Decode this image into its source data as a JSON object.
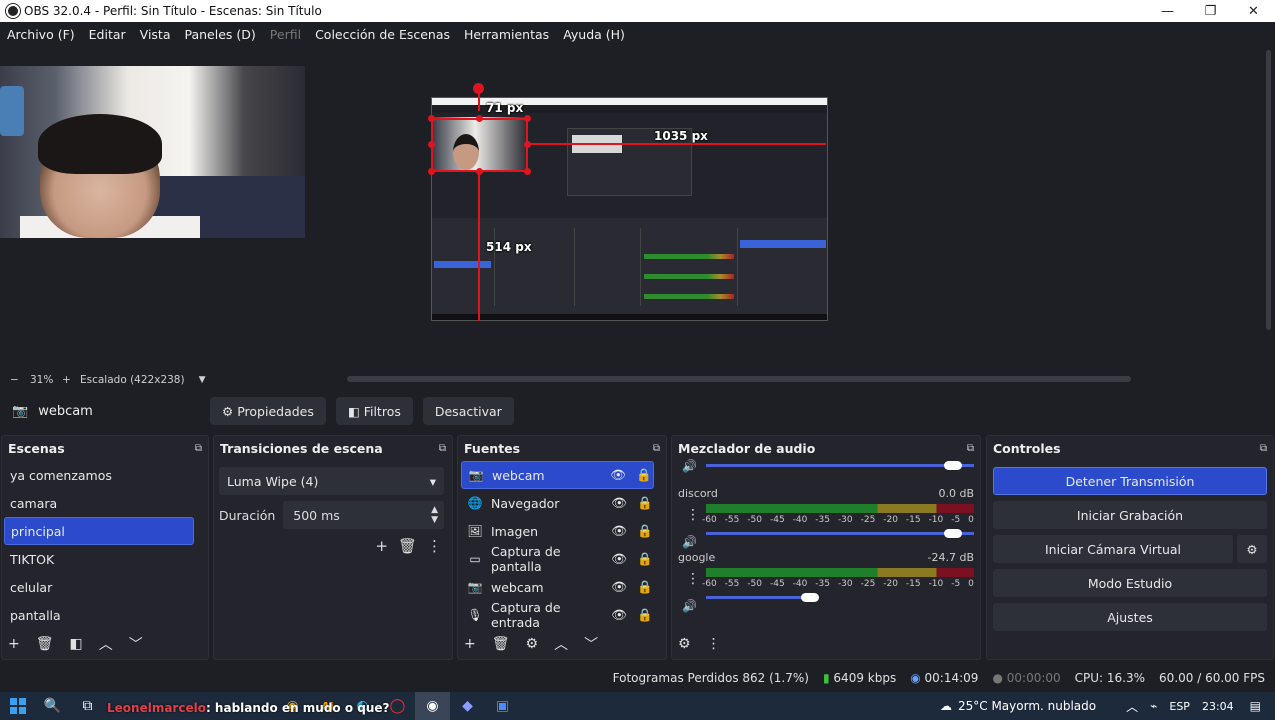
{
  "window": {
    "title": "OBS 32.0.4 - Perfil: Sin Título - Escenas: Sin Título",
    "controls": [
      "—",
      "❐",
      "✕"
    ]
  },
  "menu": [
    {
      "label": "Archivo (F)",
      "disabled": false
    },
    {
      "label": "Editar",
      "disabled": false
    },
    {
      "label": "Vista",
      "disabled": false
    },
    {
      "label": "Paneles (D)",
      "disabled": false
    },
    {
      "label": "Perfil",
      "disabled": true
    },
    {
      "label": "Colección de Escenas",
      "disabled": false
    },
    {
      "label": "Herramientas",
      "disabled": false
    },
    {
      "label": "Ayuda (H)",
      "disabled": false
    }
  ],
  "preview": {
    "labels": {
      "top": "71 px",
      "right": "1035 px",
      "left": "514 px"
    },
    "zoom": {
      "minus": "−",
      "percent": "31%",
      "plus": "+",
      "scaled": "Escalado (422x238)",
      "caret": "▼"
    }
  },
  "selected_source": {
    "name": "webcam",
    "properties": "Propiedades",
    "filters": "Filtros",
    "deactivate": "Desactivar"
  },
  "scenes": {
    "title": "Escenas",
    "items": [
      "ya comenzamos",
      "camara",
      "principal",
      "TIKTOK",
      "celular",
      "pantalla"
    ],
    "active_index": 2
  },
  "transitions": {
    "title": "Transiciones de escena",
    "selected": "Luma Wipe (4)",
    "duration_label": "Duración",
    "duration_value": "500 ms"
  },
  "sources": {
    "title": "Fuentes",
    "items": [
      {
        "label": "webcam",
        "icon": "camera-icon",
        "glyph": "📷",
        "active": true
      },
      {
        "label": "Navegador",
        "icon": "globe-icon",
        "glyph": "🌐",
        "active": false
      },
      {
        "label": "Imagen",
        "icon": "image-icon",
        "glyph": "🖼",
        "active": false
      },
      {
        "label": "Captura de pantalla",
        "icon": "monitor-icon",
        "glyph": "▭",
        "active": false
      },
      {
        "label": "webcam",
        "icon": "camera-icon",
        "glyph": "📷",
        "active": false
      },
      {
        "label": "Captura de entrada",
        "icon": "microphone-icon",
        "glyph": "🎙",
        "active": false
      }
    ]
  },
  "mixer": {
    "title": "Mezclador de audio",
    "ticks": [
      "-60",
      "-55",
      "-50",
      "-45",
      "-40",
      "-35",
      "-30",
      "-25",
      "-20",
      "-15",
      "-10",
      "-5",
      "0"
    ],
    "channels": [
      {
        "name": "discord",
        "level": "0.0 dB",
        "volume": 1.0
      },
      {
        "name": "google",
        "level": "-24.7 dB",
        "volume": 0.4
      }
    ],
    "top_volume": 1.0
  },
  "controls": {
    "title": "Controles",
    "stop_stream": "Detener Transmisión",
    "start_recording": "Iniciar Grabación",
    "virtual_cam": "Iniciar Cámara Virtual",
    "studio_mode": "Modo Estudio",
    "settings": "Ajustes"
  },
  "status": {
    "dropped": "Fotogramas Perdidos 862 (1.7%)",
    "bitrate": "6409 kbps",
    "stream_time": "00:14:09",
    "rec_time": "00:00:00",
    "cpu": "CPU: 16.3%",
    "fps": "60.00 / 60.00 FPS"
  },
  "taskbar": {
    "overlay_user": "Leonelmarcelo",
    "overlay_text": ": hablando en mudo o que?",
    "weather": "25°C  Mayorm. nublado",
    "lang": "ESP",
    "time": "23:04"
  },
  "colors": {
    "accent": "#2b4bcc",
    "panel": "#24252c",
    "bg": "#1e1f24",
    "guide": "#e0141e"
  }
}
